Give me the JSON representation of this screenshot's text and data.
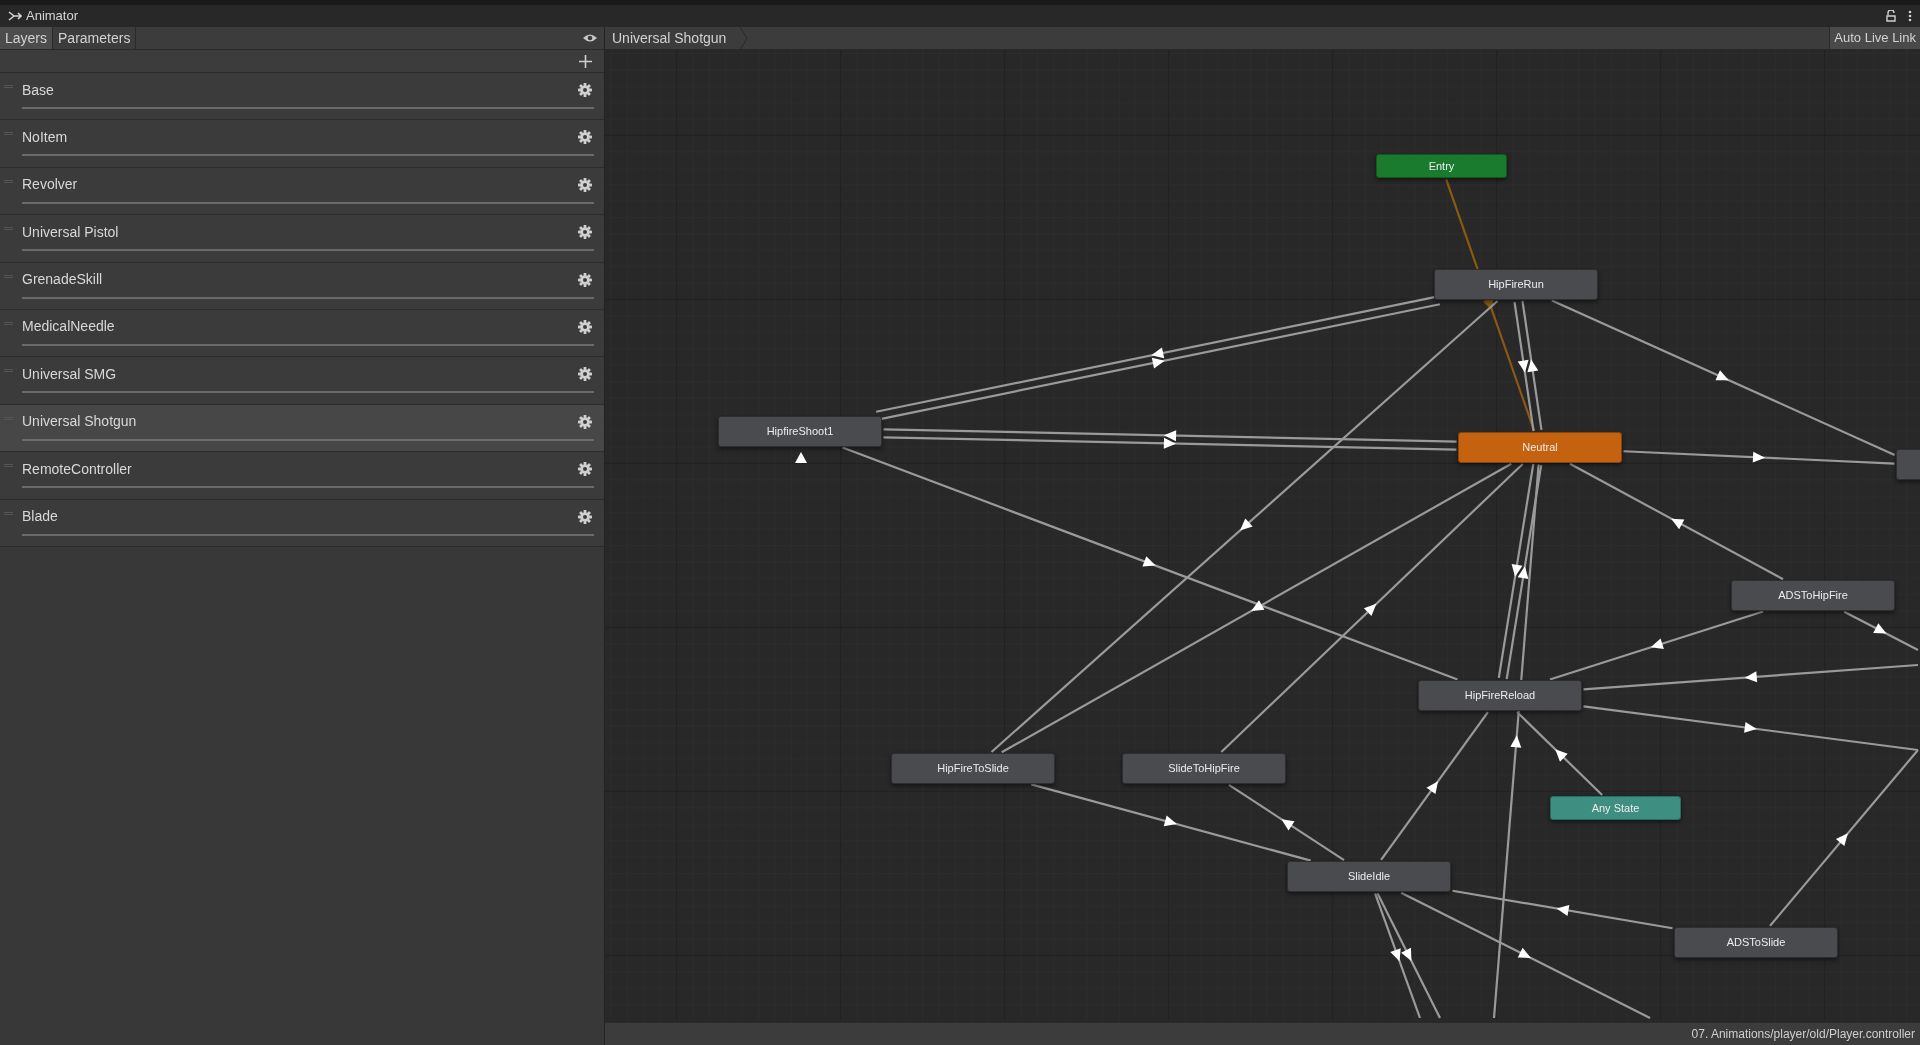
{
  "window": {
    "title": "Animator"
  },
  "tabs": [
    {
      "label": "Layers",
      "selected": true
    },
    {
      "label": "Parameters",
      "selected": false
    }
  ],
  "breadcrumb": "Universal Shotgun",
  "auto_live_link": "Auto Live Link",
  "layers": [
    {
      "name": "Base",
      "selected": false
    },
    {
      "name": "NoItem",
      "selected": false
    },
    {
      "name": "Revolver",
      "selected": false
    },
    {
      "name": "Universal Pistol",
      "selected": false
    },
    {
      "name": "GrenadeSkill",
      "selected": false
    },
    {
      "name": "MedicalNeedle",
      "selected": false
    },
    {
      "name": "Universal SMG",
      "selected": false
    },
    {
      "name": "Universal Shotgun",
      "selected": true
    },
    {
      "name": "RemoteController",
      "selected": false
    },
    {
      "name": "Blade",
      "selected": false
    }
  ],
  "graph": {
    "states": [
      {
        "label": "Entry",
        "kind": "entry"
      },
      {
        "label": "HipFireRun",
        "kind": "state"
      },
      {
        "label": "HipfireShoot1",
        "kind": "state"
      },
      {
        "label": "Neutral",
        "kind": "default"
      },
      {
        "kind": "state"
      },
      {
        "label": "ADSToHipFire",
        "kind": "state"
      },
      {
        "label": "HipFireReload",
        "kind": "state"
      },
      {
        "label": "HipFireToSlide",
        "kind": "state"
      },
      {
        "label": "SlideToHipFire",
        "kind": "state"
      },
      {
        "label": "Any State",
        "kind": "any"
      },
      {
        "label": "SlideIdle",
        "kind": "state"
      },
      {
        "label": "ADSToSlide",
        "kind": "state"
      }
    ]
  },
  "status_bar": "07. Animations/player/old/Player.controller"
}
